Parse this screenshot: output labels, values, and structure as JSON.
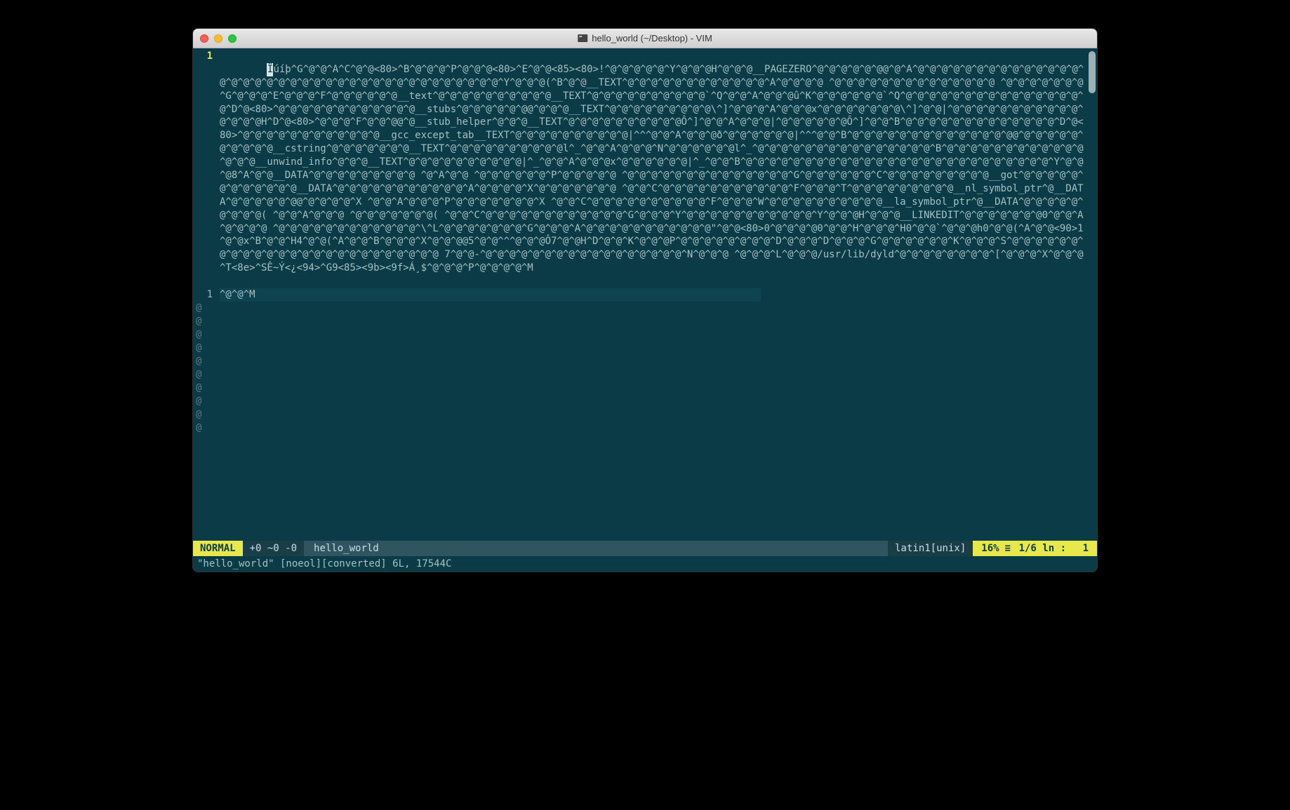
{
  "window": {
    "title": "hello_world (~/Desktop) - VIM"
  },
  "gutter": {
    "line1": "1",
    "line2": "1"
  },
  "buffer": {
    "line1_cursor_char": "Ï",
    "line1_wrapped": [
      "úíþ^G^@^@^A^C^@^@<80>^B^@^@^@^P^@^@^@<80>^E^@^@<85><80>!^@^@^@^@^@^Y^@^@^@H^@^@^@__PAGEZERO^@^@^@^@^@^@",
      "@^@^A^@^@^@^@^@^@^@^@^@^@^@^@^@^@^@^@^@^@^@^@^@^@^@^@^@^@^@^@^@^@^@^@^@^@^@^@^@^@^Y^@^@^@(^B^@^@__TEXT^@^@^@^@^@^@^@^@^@^@^@^@^",
      "A^@^@^@^@ ^@^@^@^@^@^@^@^@^@^@^@^@^@^@ ^@^@^@^@^@^@^@^G^@^@^@^E^@^@^@^F^@^@^@^@^@^@__text^@^@^@^@^@^@^@^@^@^@__TEXT^@^@^@^@",
      "^@^@^@^@^@^@`^Q^@^@^A^@^@^@û^K^@^@^@^@^@^@`^Q^@^@^@^@^@^@^@^@^@^@^@^@^@^@^@^@^D^@<80>^@^@^@^@^@^@^@^@^@^@^@^@__stubs^@^@^@^@^@^@",
      "@^@^@^@__TEXT^@^@^@^@^@^@^@^@^@\\^]^@^@^@^A^@^@^@x^@^@^@^@^@^@^@\\^]^@^@|^@^@^@^@^@^@^@^@^@^@^@^@^@^@^@H^D^@<80>^@^@^@^F^@^@^@",
      "@^@__stub_helper^@^@^@__TEXT^@^@^@^@^@^@^@^@^@^@Ô^]^@^@^A^@^@^@|^@^@^@^@^@^@Ô^]^@^@^B^@^@^@^@^@^@^@^@^@^@^@^@^@^D^@<80>^@^@^@",
      "^@^@^@^@^@^@^@^@^@__gcc_except_tab__TEXT^@^@^@^@^@^@^@^@^@^@|^^^@^@^A^@^@^@ð^@^@^@^@^@^@|^^^@^@^B^@^@^@^@^@^@^@^@^@^@^@^@^@^@",
      "@^@^@^@^@^@^@^@^@^@^@__cstring^@^@^@^@^@^@^@__TEXT^@^@^@^@^@^@^@^@^@^@l^_^@^@^A^@^@^@^N^@^@^@^@^@^@l^_^@^@^@^@^@^@^@^@^@",
      "^@^@^@^@^@^@^B^@^@^@^@^@^@^@^@^@^@^@^@^@^@^@__unwind_info^@^@^@__TEXT^@^@^@^@^@^@^@^@^@^@|^_^@^@^A^@^@^@x^@^@^@^@^@^@|^_^",
      "@^@^B^@^@^@^@^@^@^@^@^@^@^@^@^@^@^@^@^@^@^@^@^@^@^@^@^@^@^Y^@^@^@8^A^@^@__DATA^@^@^@^@^@^@^@^@^@ ^@^A^@^@ ^@^@^@^@^@^@^P^@^",
      "@^@^@^@ ^@^@^@^@^@^@^@^@^@^@^@^@^@^@^G^@^@^@^@^@^@^C^@^@^@^@^@^@^@^@^@__got^@^@^@^@^@^@^@^@^@^@^@^@__DATA^@^@^@^@^@^@^@^@^@",
      "^@^@^A^@^@^@^@^X^@^@^@^@^@^@^@ ^@^@^C^@^@^@^@^@^@^@^@^@^@^@^F^@^@^@^T^@^@^@^@^@^@^@^@^@__nl_symbol_ptr^@__DATA^@^@^@^@^@^@",
      "@^@^@^@^@^X ^@^@^A^@^@^@^P^@^@^@^@^@^@^@^X ^@^@^C^@^@^@^@^@^@^@^@^@^@^F^@^@^@^W^@^@^@^@^@^@^@^@^@^@__la_symbol_ptr^@__DAT",
      "A^@^@^@^@^@^@^@^@^@( ^@^@^A^@^@^@ ^@^@^@^@^@^@^@( ^@^@^C^@^@^@^@^@^@^@^@^@^@^@^@^G^@^@^@^Y^@^@^@^@^@^@^@^@^@^@^@^Y^@^@^@H^@^@",
      "^@__LINKEDIT^@^@^@^@^@^@^@0^@^@^A^@^@^@^@ ^@^@^@^@^@^@^@^@^@^@^@^@^\\^L^@^@^@^@^@^@^@^G^@^@^@^A^@^@^@^@^@^@^@^@^@^@^@\"^@^@<8",
      "0>0^@^@^@^@0^@^@^H^@^@^@^H0^@^@`^@^@^@h0^@^@(^A^@^@<90>1^@^@x^B^@^@^H4^@^@(^A^@^@^B^@^@^@^X^@^@^@@5^@^@^^^@^@^@Ô7^@^@H^D^@^@^",
      "K^@^@^@P^@^@^@^@^@^@^@^@^D^@^@^@^D^@^@^@^G^@^@^@^@^@^@^K^@^@^@^S^@^@^@^@^@^@^@^@^@^@^@^@^@^@^@^@^@^@^@^@^@^@^@^@^@ 7^@^@-^@^@^@^@^",
      "@^@^@^@^@^@^@^@^@^@^@^@^@^N^@^@^@ ^@^@^@^L^@^@^@/usr/lib/dyld^@^@^@^@^@^@^@^@^[^@^@^@^X^@^@^@^T<8e>^SÊ~Ý<¿<94>^G9<85><9b><",
      "9f>Á¸$^@^@^@^P^@^@^@^@^M"
    ],
    "line2": "^@^@^M"
  },
  "tilde_count": 10,
  "tilde_char": "@",
  "statusline": {
    "mode": "NORMAL",
    "nums": "+0 ~0 -0",
    "filename": "hello_world",
    "encoding": "latin1",
    "fileformat": "[unix]",
    "percent": "16%",
    "position": "1/6 ln :",
    "col": "1"
  },
  "commandline": "\"hello_world\" [noeol][converted] 6L, 17544C"
}
